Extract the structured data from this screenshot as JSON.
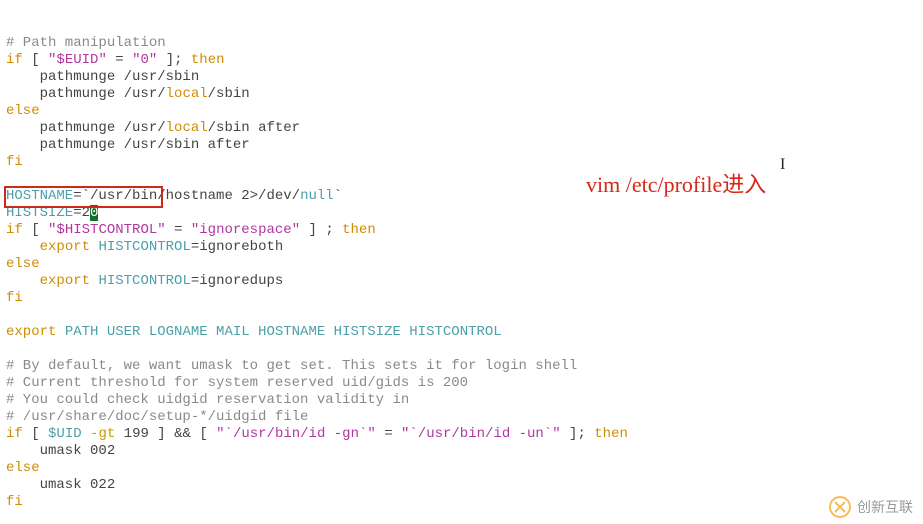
{
  "annotation": {
    "text": "vim /etc/profile进入"
  },
  "watermark": {
    "text": "创新互联"
  },
  "code": {
    "c_pathmanip": "# Path manipulation",
    "kw_if": "if",
    "pnc_lb": "[",
    "v_euid_q": "\"$EUID\"",
    "eq": "=",
    "s_zero": "\"0\"",
    "pnc_rb": "]",
    "sc": ";",
    "kw_then": "then",
    "l_pm_usr_sbin": "    pathmunge /usr/sbin",
    "l_pm_usr_local_sbin_a": "    pathmunge /usr/",
    "l_pm_usr_local_sbin_b": "local",
    "l_pm_usr_local_sbin_c": "/sbin",
    "kw_else": "else",
    "l_pm_usr_local_sbin_after_a": "    pathmunge /usr/",
    "l_pm_usr_local_sbin_after_b": "local",
    "l_pm_usr_local_sbin_after_c": "/sbin after",
    "l_pm_usr_sbin_after": "    pathmunge /usr/sbin after",
    "kw_fi": "fi",
    "v_hostname": "HOSTNAME",
    "hostname_val_a": "=`/usr/bin/hostname 2>/dev/",
    "hostname_val_b": "null",
    "hostname_val_c": "`",
    "v_histsize": "HISTSIZE",
    "histsize_eq": "=",
    "histsize_val_pre": "2",
    "histsize_val_cur": "0",
    "v_histcontrol_q": "\"$HISTCONTROL\"",
    "s_ignorespace": "\"ignorespace\"",
    "kw_export": "export",
    "v_histcontrol": "HISTCONTROL",
    "eq_plain": "=",
    "val_ignoreboth": "ignoreboth",
    "val_ignoredups": "ignoredups",
    "l_export_all_a": "export",
    "l_export_all_b": " PATH USER LOGNAME MAIL HOSTNAME HISTSIZE HISTCONTROL",
    "c_bydefault": "# By default, we want umask to get set. This sets it for login shell",
    "c_threshold": "# Current threshold for system reserved uid/gids is 200",
    "c_uidgid": "# You could check uidgid reservation validity in",
    "c_uidgidfile": "# /usr/share/doc/setup-*/uidgid file",
    "v_uid": "$UID",
    "kw_gt": "-gt",
    "n_199": "199",
    "and": "&&",
    "s_id_gn": "\"`/usr/bin/id -gn`\"",
    "s_id_un": "\"`/usr/bin/id -un`\"",
    "l_umask002": "    umask 002",
    "l_umask022": "    umask 022"
  }
}
